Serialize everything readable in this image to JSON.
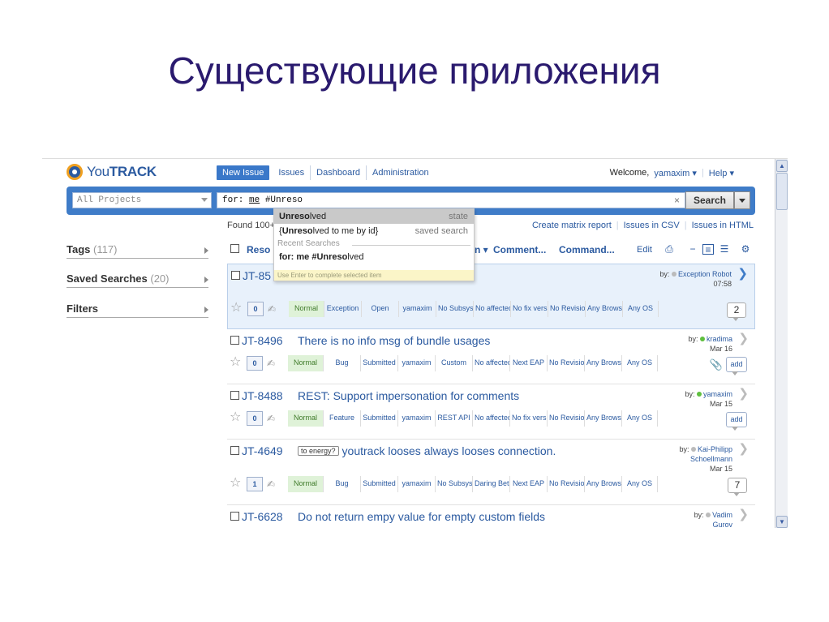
{
  "slide": {
    "title": "Существующие приложения"
  },
  "app": {
    "logo": {
      "you": "You",
      "track": "TRACK"
    },
    "nav": [
      "New Issue",
      "Issues",
      "Dashboard",
      "Administration"
    ],
    "welcome": {
      "text": "Welcome,",
      "user": "yamaxim",
      "help": "Help"
    },
    "search": {
      "project": "All Projects",
      "query_prefix": "for: ",
      "query_me": "me",
      "query_rest": " #Unreso",
      "clear": "×",
      "button": "Search"
    },
    "autocomplete": {
      "items": [
        {
          "bold": "Unreso",
          "rest": "lved",
          "right": "state"
        },
        {
          "pre": "{",
          "bold": "Unreso",
          "rest": "lved to me by id}",
          "right": "saved search"
        }
      ],
      "section": "Recent Searches",
      "recent": {
        "bold": "for: me #Unreso",
        "rest": "lved"
      },
      "hint": "Use Enter to complete selected item"
    },
    "found": "Found 100+",
    "links": [
      "Create matrix report",
      "Issues in CSV",
      "Issues in HTML"
    ],
    "sidebar": {
      "tags": {
        "label": "Tags",
        "count": "(117)"
      },
      "saved": {
        "label": "Saved Searches",
        "count": "(20)"
      },
      "filters": {
        "label": "Filters"
      }
    },
    "toolbar": {
      "col1": "Reso",
      "col2": "n ▾",
      "comment": "Comment...",
      "command": "Command...",
      "edit": "Edit"
    },
    "issues": [
      {
        "id": "JT-85",
        "summary": "",
        "tag": "",
        "votes": "0",
        "fields": [
          "Normal",
          "Exception",
          "Open",
          "yamaxim",
          "No Subsystem",
          "No affected",
          "No fix version",
          "No Revision",
          "Any Browser",
          "Any OS"
        ],
        "reporter_by": "by:",
        "reporter": "Exception Robot",
        "reporter_line2": "",
        "date": "07:58",
        "comments": "2",
        "dot_color": "#bbbbbb"
      },
      {
        "id": "JT-8496",
        "summary": "There is no info msg of bundle usages",
        "tag": "",
        "votes": "0",
        "fields": [
          "Normal",
          "Bug",
          "Submitted",
          "yamaxim",
          "Custom",
          "No affected",
          "Next EAP",
          "No Revision",
          "Any Browser",
          "Any OS"
        ],
        "reporter_by": "by:",
        "reporter": "kradima",
        "reporter_line2": "",
        "date": "Mar 16",
        "comments": "add",
        "dot_color": "#5fbf3f"
      },
      {
        "id": "JT-8488",
        "summary": "REST: Support impersonation for comments",
        "tag": "",
        "votes": "0",
        "fields": [
          "Normal",
          "Feature",
          "Submitted",
          "yamaxim",
          "REST API",
          "No affected",
          "No fix version",
          "No Revision",
          "Any Browser",
          "Any OS"
        ],
        "reporter_by": "by:",
        "reporter": "yamaxim",
        "reporter_line2": "",
        "date": "Mar 15",
        "comments": "add",
        "dot_color": "#5fbf3f"
      },
      {
        "id": "JT-4649",
        "summary": "youtrack looses always looses connection.",
        "tag": "to energy?",
        "votes": "1",
        "fields": [
          "Normal",
          "Bug",
          "Submitted",
          "yamaxim",
          "No Subsystem",
          "Daring Beta",
          "Next EAP",
          "No Revision",
          "Any Browser",
          "Any OS"
        ],
        "reporter_by": "by:",
        "reporter": "Kai-Philipp",
        "reporter_line2": "Schoellmann",
        "date": "Mar 15",
        "comments": "7",
        "dot_color": "#bbbbbb"
      },
      {
        "id": "JT-6628",
        "summary": "Do not return empy value for empty custom fields",
        "tag": "",
        "votes": "",
        "fields": [],
        "reporter_by": "by:",
        "reporter": "Vadim",
        "reporter_line2": "Gurov",
        "date": "",
        "comments": "",
        "dot_color": "#bbbbbb"
      }
    ],
    "colors": {
      "accent": "#3f7cc8",
      "link": "#2b5aa0",
      "priority_bg": "#dff2d8",
      "title": "#2a1a6e"
    }
  }
}
